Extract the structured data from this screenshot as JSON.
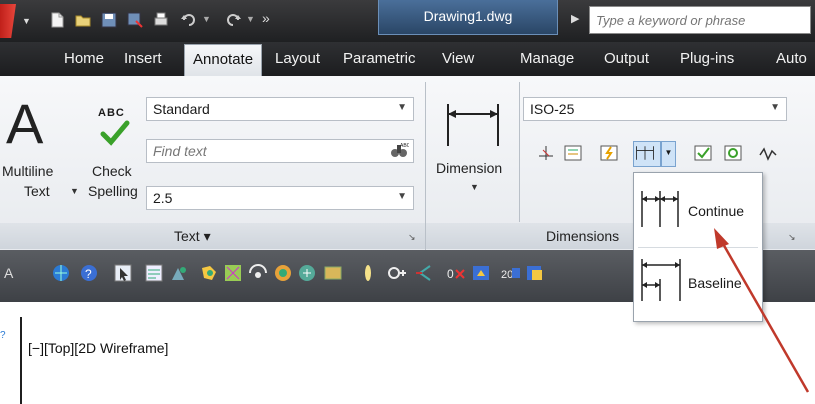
{
  "titlebar": {
    "document_title": "Drawing1.dwg",
    "search_placeholder": "Type a keyword or phrase",
    "overflow_glyph": "»"
  },
  "tabs": [
    {
      "label": "Home",
      "active": false
    },
    {
      "label": "Insert",
      "active": false
    },
    {
      "label": "Annotate",
      "active": true
    },
    {
      "label": "Layout",
      "active": false
    },
    {
      "label": "Parametric",
      "active": false
    },
    {
      "label": "View",
      "active": false
    },
    {
      "label": "Manage",
      "active": false
    },
    {
      "label": "Output",
      "active": false
    },
    {
      "label": "Plug-ins",
      "active": false
    },
    {
      "label": "Auto",
      "active": false
    }
  ],
  "text_panel": {
    "multiline_text_line1": "Multiline",
    "multiline_text_line2": "Text",
    "check_badge": "ABC",
    "check_spelling_line1": "Check",
    "check_spelling_line2": "Spelling",
    "text_style": "Standard",
    "find_text_placeholder": "Find text",
    "text_height": "2.5",
    "panel_title": "Text ▾"
  },
  "dimensions_panel": {
    "dimension_label": "Dimension",
    "dim_style": "ISO-25",
    "panel_title": "Dimensions"
  },
  "dropdown": {
    "items": [
      {
        "label": "Continue"
      },
      {
        "label": "Baseline"
      }
    ]
  },
  "viewport": {
    "label": "[−][Top][2D Wireframe]"
  },
  "colors": {
    "accent_blue": "#2a4666",
    "check_green": "#3aa12a",
    "annotation_arrow": "#c0392b"
  }
}
